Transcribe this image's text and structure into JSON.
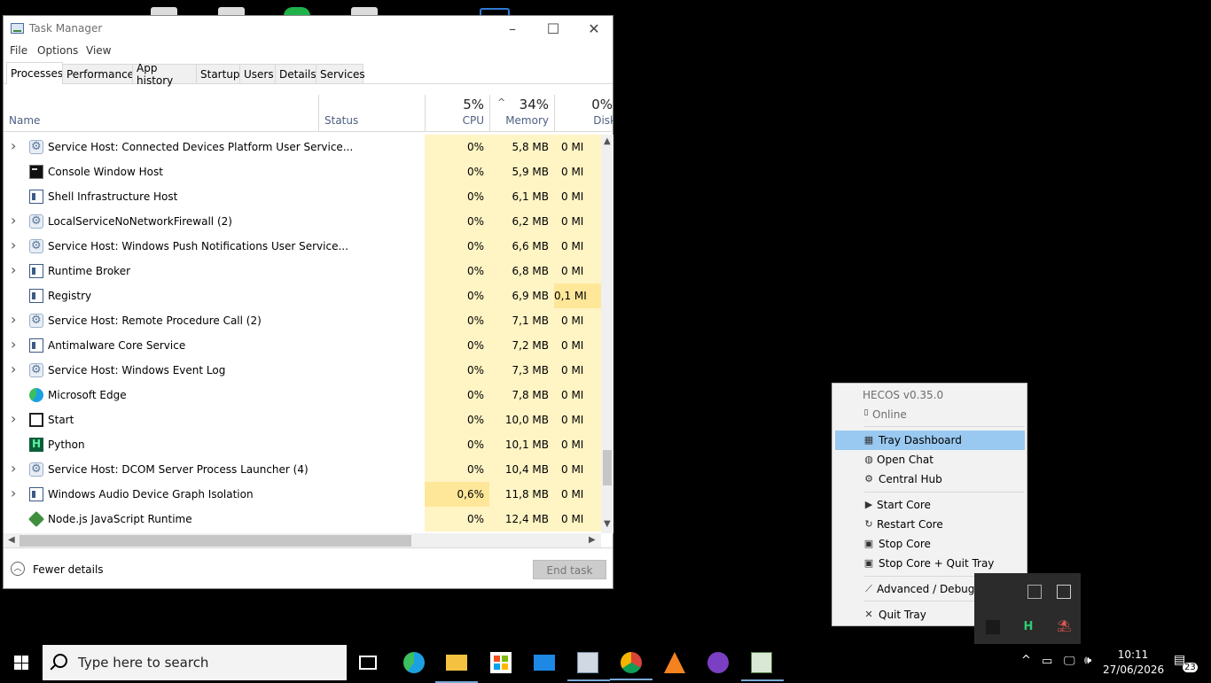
{
  "task_manager": {
    "title": "Task Manager",
    "menu": [
      "File",
      "Options",
      "View"
    ],
    "tabs": [
      "Processes",
      "Performance",
      "App history",
      "Startup",
      "Users",
      "Details",
      "Services"
    ],
    "active_tab": "Processes",
    "columns": {
      "name": "Name",
      "status": "Status",
      "cpu": {
        "pct": "5%",
        "label": "CPU"
      },
      "memory": {
        "pct": "34%",
        "label": "Memory"
      },
      "disk": {
        "pct": "0%",
        "label": "Disk"
      }
    },
    "processes": [
      {
        "name": "Service Host: Connected Devices Platform User Service...",
        "expand": true,
        "icon": "gear-icon",
        "cpu": "0%",
        "mem": "5,8 MB",
        "disk": "0 MI"
      },
      {
        "name": "Console Window Host",
        "expand": false,
        "icon": "console-icon",
        "cpu": "0%",
        "mem": "5,9 MB",
        "disk": "0 MI"
      },
      {
        "name": "Shell Infrastructure Host",
        "expand": false,
        "icon": "window-icon",
        "cpu": "0%",
        "mem": "6,1 MB",
        "disk": "0 MI"
      },
      {
        "name": "LocalServiceNoNetworkFirewall (2)",
        "expand": true,
        "icon": "gear-icon",
        "cpu": "0%",
        "mem": "6,2 MB",
        "disk": "0 MI"
      },
      {
        "name": "Service Host: Windows Push Notifications User Service...",
        "expand": true,
        "icon": "gear-icon",
        "cpu": "0%",
        "mem": "6,6 MB",
        "disk": "0 MI"
      },
      {
        "name": "Runtime Broker",
        "expand": true,
        "icon": "window-icon",
        "cpu": "0%",
        "mem": "6,8 MB",
        "disk": "0 MI"
      },
      {
        "name": "Registry",
        "expand": false,
        "icon": "window-icon",
        "cpu": "0%",
        "mem": "6,9 MB",
        "disk": "0,1 MI"
      },
      {
        "name": "Service Host: Remote Procedure Call (2)",
        "expand": true,
        "icon": "gear-icon",
        "cpu": "0%",
        "mem": "7,1 MB",
        "disk": "0 MI"
      },
      {
        "name": "Antimalware Core Service",
        "expand": true,
        "icon": "window-icon",
        "cpu": "0%",
        "mem": "7,2 MB",
        "disk": "0 MI"
      },
      {
        "name": "Service Host: Windows Event Log",
        "expand": true,
        "icon": "gear-icon",
        "cpu": "0%",
        "mem": "7,3 MB",
        "disk": "0 MI"
      },
      {
        "name": "Microsoft Edge",
        "expand": false,
        "icon": "edge-icon",
        "cpu": "0%",
        "mem": "7,8 MB",
        "disk": "0 MI"
      },
      {
        "name": "Start",
        "expand": true,
        "icon": "start-icon",
        "cpu": "0%",
        "mem": "10,0 MB",
        "disk": "0 MI"
      },
      {
        "name": "Python",
        "expand": false,
        "icon": "python-icon",
        "cpu": "0%",
        "mem": "10,1 MB",
        "disk": "0 MI"
      },
      {
        "name": "Service Host: DCOM Server Process Launcher (4)",
        "expand": true,
        "icon": "gear-icon",
        "cpu": "0%",
        "mem": "10,4 MB",
        "disk": "0 MI"
      },
      {
        "name": "Windows Audio Device Graph Isolation",
        "expand": true,
        "icon": "window-icon",
        "cpu": "0,6%",
        "mem": "11,8 MB",
        "disk": "0 MI"
      },
      {
        "name": "Node.js JavaScript Runtime",
        "expand": false,
        "icon": "nodejs-icon",
        "cpu": "0%",
        "mem": "12,4 MB",
        "disk": "0 MI"
      }
    ],
    "footer": {
      "fewer_details": "Fewer details",
      "end_task": "End task"
    }
  },
  "tray_menu": {
    "header": "HECOS  v0.35.0",
    "status": "Online",
    "items": [
      {
        "label": "Tray Dashboard",
        "icon": "dashboard-icon",
        "glyph": "▦"
      },
      {
        "label": "Open Chat",
        "icon": "chat-icon",
        "glyph": "◍"
      },
      {
        "label": "Central Hub",
        "icon": "hub-icon",
        "glyph": "⚙"
      },
      {
        "label": "Start Core",
        "icon": "play-icon",
        "glyph": "▶"
      },
      {
        "label": "Restart Core",
        "icon": "restart-icon",
        "glyph": "↻"
      },
      {
        "label": "Stop Core",
        "icon": "stop-icon",
        "glyph": "▣"
      },
      {
        "label": "Stop Core + Quit Tray",
        "icon": "stop-quit-icon",
        "glyph": "▣"
      },
      {
        "label": "Advanced / Debug",
        "icon": "wrench-icon",
        "glyph": "⟋"
      },
      {
        "label": "Quit Tray",
        "icon": "close-icon",
        "glyph": "✕"
      }
    ]
  },
  "taskbar": {
    "search_placeholder": "Type here to search",
    "time": "10:11",
    "date": "27/06/2026",
    "notification_count": "23",
    "pinned": [
      "task-view-icon",
      "edge-icon",
      "file-explorer-icon",
      "store-icon",
      "mail-icon",
      "photos-icon",
      "chrome-icon",
      "vlc-icon",
      "github-icon",
      "task-manager-icon"
    ]
  },
  "colors": {
    "selection": "#99c9f0",
    "heat": "#fff4c4",
    "heat_hot": "#ffe79a"
  }
}
